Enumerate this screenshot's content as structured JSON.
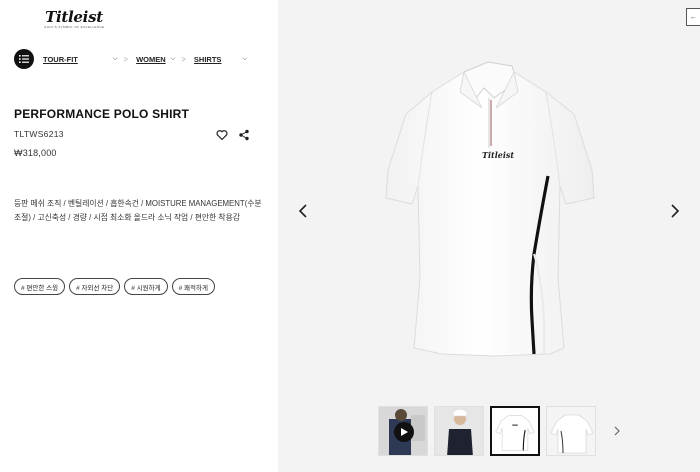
{
  "brand": {
    "logo_text": "Titleist",
    "tagline": "GOLF'S SYMBOL OF EXCELLENCE"
  },
  "breadcrumb": {
    "items": [
      {
        "label": "TOUR-FIT"
      },
      {
        "label": "WOMEN"
      },
      {
        "label": "SHIRTS"
      }
    ],
    "separator": ">"
  },
  "product": {
    "name": "PERFORMANCE POLO SHIRT",
    "code": "TLTWS6213",
    "price": "₩318,000",
    "description": "등판 메쉬 조직 / 벤틸레이션 / 흡한속건 / MOISTURE MANAGEMENT(수분 조절) / 고신축성 / 경량 / 시접 최소화 올드라 소닉 작업 / 편안한 착용감",
    "chest_logo": "Titleist"
  },
  "tags": [
    "# 편안한 스윙",
    "# 자외선 차단",
    "# 시원하게",
    "# 쾌적하게"
  ],
  "gallery": {
    "thumbnail_count": 4,
    "active_index": 2,
    "top_control_label": "←"
  },
  "icons": {
    "menu": "list-icon",
    "wishlist": "heart-icon",
    "share": "share-icon",
    "prev": "chevron-left-icon",
    "next": "chevron-right-icon",
    "play": "play-icon"
  },
  "colors": {
    "accent": "#111111",
    "panel_bg": "#f3f3f3",
    "shirt": "#ffffff",
    "stripe": "#111111"
  }
}
